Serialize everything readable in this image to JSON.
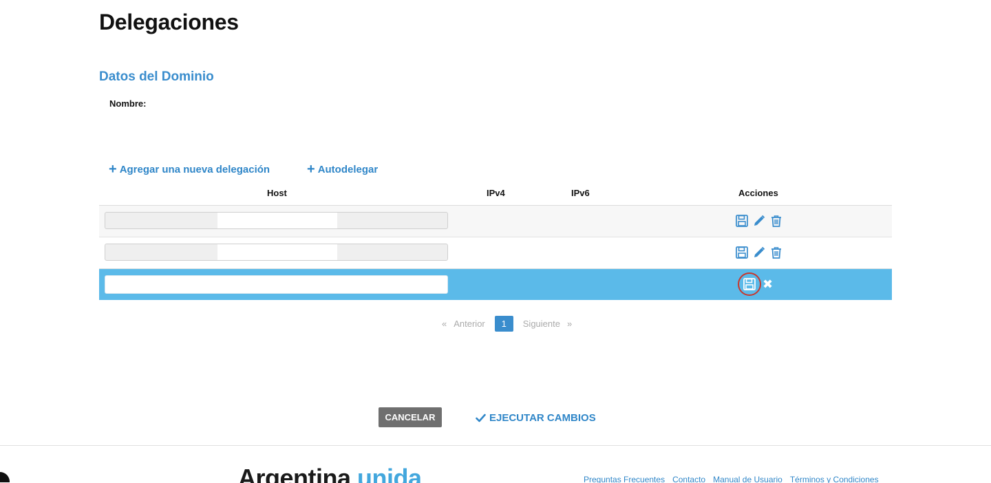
{
  "page": {
    "title": "Delegaciones"
  },
  "domain": {
    "section_title": "Datos del Dominio",
    "nombre_label": "Nombre:"
  },
  "actions": {
    "add_delegation": "Agregar una nueva delegación",
    "autodelegate": "Autodelegar"
  },
  "table": {
    "headers": {
      "host": "Host",
      "ipv4": "IPv4",
      "ipv6": "IPv6",
      "acciones": "Acciones"
    },
    "rows": [
      {
        "host": ""
      },
      {
        "host": ""
      },
      {
        "host": ""
      }
    ]
  },
  "pagination": {
    "prev_arrow": "«",
    "prev": "Anterior",
    "current": "1",
    "next": "Siguiente",
    "next_arrow": "»"
  },
  "buttons": {
    "cancel": "CANCELAR",
    "execute": "EJECUTAR CAMBIOS"
  },
  "footer": {
    "logo_part1": "Argentina",
    "logo_part2": "unida",
    "links": [
      "Preguntas Frecuentes",
      "Contacto",
      "Manual de Usuario",
      "Términos y Condiciones"
    ]
  },
  "colors": {
    "accent": "#3a8dcd",
    "row_active": "#5bbae9",
    "highlight_ring": "#c9372c",
    "cancel_button": "#6f6f6f"
  },
  "icons": {
    "save": "floppy-disk-icon",
    "edit": "pencil-icon",
    "delete": "trash-icon",
    "close": "close-icon",
    "plus": "plus-icon",
    "check": "check-icon"
  }
}
